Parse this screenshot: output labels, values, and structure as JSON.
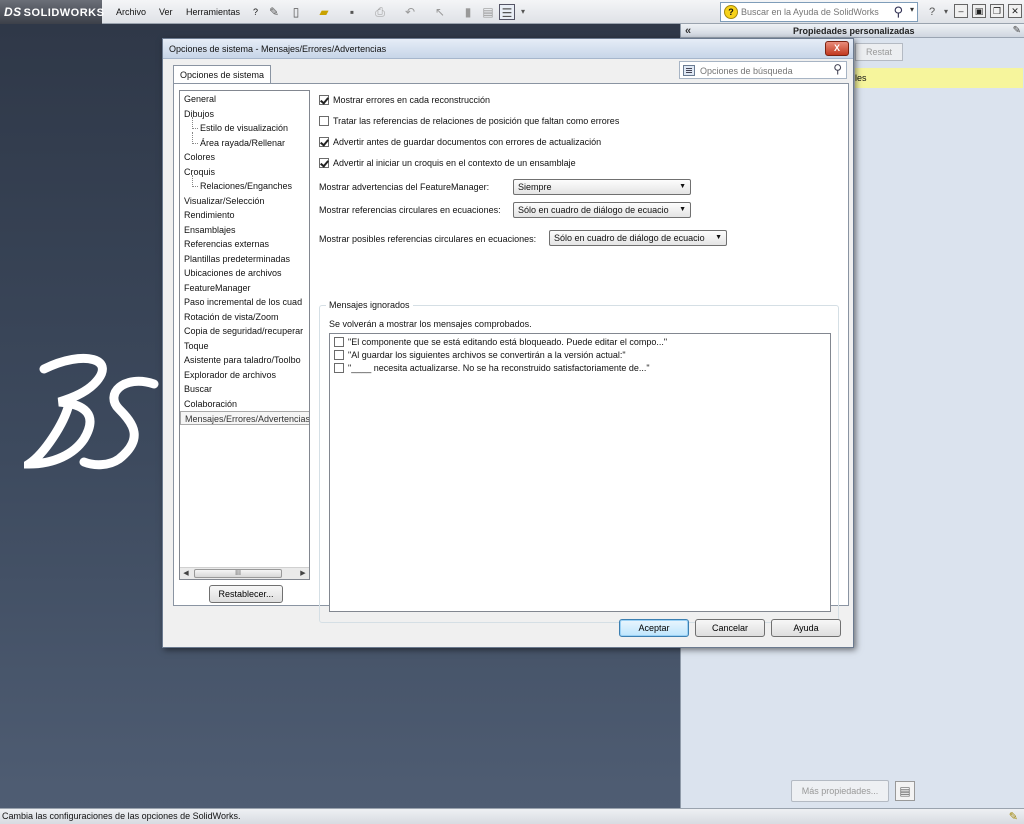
{
  "app": {
    "logo_ds": "DS",
    "logo_text": "SOLIDWORKS",
    "menu": [
      "Archivo",
      "Ver",
      "Herramientas",
      "?"
    ],
    "help_search_placeholder": "Buscar en la Ayuda de SolidWorks"
  },
  "taskpane": {
    "title": "Propiedades personalizadas",
    "reset_label": "Restat",
    "highlight_text": "les",
    "more_label": "Más propiedades..."
  },
  "status": {
    "text": "Cambia las configuraciones de las opciones de SolidWorks."
  },
  "dialog": {
    "title": "Opciones de sistema - Mensajes/Errores/Advertencias",
    "close_label": "X",
    "tab_label": "Opciones de sistema",
    "search_placeholder": "Opciones de búsqueda",
    "tree": [
      {
        "label": "General",
        "level": 0
      },
      {
        "label": "Dibujos",
        "level": 0
      },
      {
        "label": "Estilo de visualización",
        "level": 1
      },
      {
        "label": "Área rayada/Rellenar",
        "level": 1
      },
      {
        "label": "Colores",
        "level": 0
      },
      {
        "label": "Croquis",
        "level": 0
      },
      {
        "label": "Relaciones/Enganches",
        "level": 1
      },
      {
        "label": "Visualizar/Selección",
        "level": 0
      },
      {
        "label": "Rendimiento",
        "level": 0
      },
      {
        "label": "Ensamblajes",
        "level": 0
      },
      {
        "label": "Referencias externas",
        "level": 0
      },
      {
        "label": "Plantillas predeterminadas",
        "level": 0
      },
      {
        "label": "Ubicaciones de archivos",
        "level": 0
      },
      {
        "label": "FeatureManager",
        "level": 0
      },
      {
        "label": "Paso incremental de los cuad",
        "level": 0
      },
      {
        "label": "Rotación de vista/Zoom",
        "level": 0
      },
      {
        "label": "Copia de seguridad/recuperar",
        "level": 0
      },
      {
        "label": "Toque",
        "level": 0
      },
      {
        "label": "Asistente para taladro/Toolbo",
        "level": 0
      },
      {
        "label": "Explorador de archivos",
        "level": 0
      },
      {
        "label": "Buscar",
        "level": 0
      },
      {
        "label": "Colaboración",
        "level": 0
      },
      {
        "label": "Mensajes/Errores/Advertencias",
        "level": 0,
        "selected": true
      }
    ],
    "scroll_grip": "III",
    "reset_button": "Restablecer...",
    "checks": [
      {
        "label": "Mostrar errores en cada reconstrucción",
        "checked": true
      },
      {
        "label": "Tratar las referencias de relaciones de posición que faltan como errores",
        "checked": false
      },
      {
        "label": "Advertir antes de guardar documentos con errores de actualización",
        "checked": true
      },
      {
        "label": "Advertir al iniciar un croquis en el contexto de un ensamblaje",
        "checked": true
      }
    ],
    "fields": {
      "fm_warnings_label": "Mostrar advertencias del FeatureManager:",
      "fm_warnings_value": "Siempre",
      "circular_label": "Mostrar referencias circulares en ecuaciones:",
      "circular_value": "Sólo en cuadro de diálogo de ecuacio",
      "possible_circular_label": "Mostrar posibles referencias circulares en ecuaciones:",
      "possible_circular_value": "Sólo en cuadro de diálogo de ecuacio"
    },
    "ignored": {
      "legend": "Mensajes ignorados",
      "note": "Se volverán a mostrar los mensajes comprobados.",
      "items": [
        "\"El componente que se está editando está bloqueado. Puede editar el compo...\"",
        "\"Al guardar los siguientes archivos se convertirán a la versión actual:\"",
        "\"____ necesita actualizarse.  No se ha reconstruido satisfactoriamente de...\""
      ]
    },
    "buttons": {
      "ok": "Aceptar",
      "cancel": "Cancelar",
      "help": "Ayuda"
    }
  }
}
